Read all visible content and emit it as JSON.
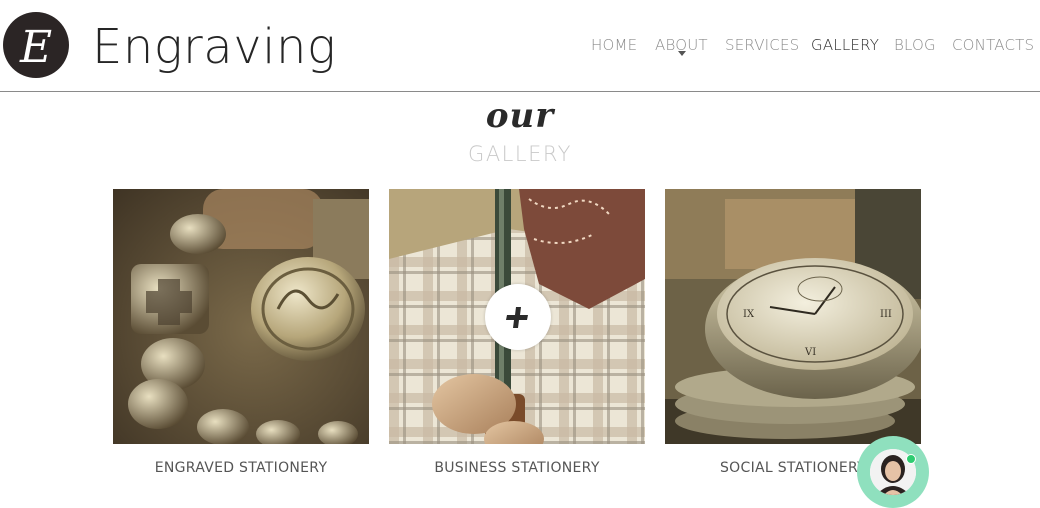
{
  "header": {
    "logo_letter": "E",
    "site_name": "Engraving",
    "nav": [
      {
        "label": "HOME",
        "active": false
      },
      {
        "label": "ABOUT",
        "active": false,
        "has_dropdown": true
      },
      {
        "label": "SERVICES",
        "active": false
      },
      {
        "label": "GALLERY",
        "active": true
      },
      {
        "label": "BLOG",
        "active": false
      },
      {
        "label": "CONTACTS",
        "active": false
      }
    ]
  },
  "section": {
    "script_title": "our",
    "title": "GALLERY"
  },
  "gallery": {
    "items": [
      {
        "caption": "ENGRAVED STATIONERY",
        "image": "silver-bracelet-photo"
      },
      {
        "caption": "BUSINESS STATIONERY",
        "image": "cowboy-rifle-photo",
        "hover_icon": "plus-icon"
      },
      {
        "caption": "SOCIAL STATIONERY",
        "image": "pocket-watch-photo"
      }
    ]
  },
  "chat_widget": {
    "icon": "support-avatar-icon",
    "status": "online",
    "accent_color": "#8fe0be"
  },
  "colors": {
    "text_dark": "#262626",
    "nav_inactive": "#8b8b8b",
    "subtitle": "#c9c9c9",
    "logo_bg": "#2b2525"
  }
}
